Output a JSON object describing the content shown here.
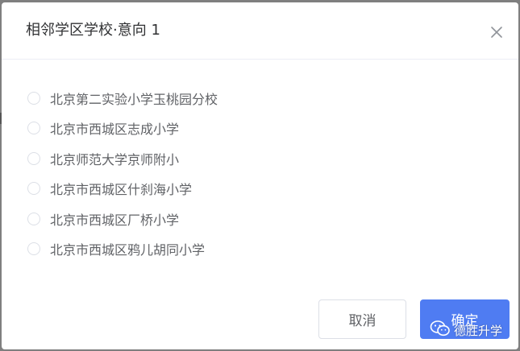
{
  "dialog": {
    "title": "相邻学区学校·意向 1",
    "close_icon": "close-icon",
    "options": [
      {
        "label": "北京第二实验小学玉桃园分校",
        "selected": false
      },
      {
        "label": "北京市西城区志成小学",
        "selected": false
      },
      {
        "label": "北京师范大学京师附小",
        "selected": false
      },
      {
        "label": "北京市西城区什刹海小学",
        "selected": false
      },
      {
        "label": "北京市西城区厂桥小学",
        "selected": false
      },
      {
        "label": "北京市西城区鸦儿胡同小学",
        "selected": false
      }
    ],
    "cancel_label": "取消",
    "confirm_label": "确定"
  },
  "watermark": {
    "icon": "wechat-icon",
    "text": "德胜升学"
  },
  "colors": {
    "primary": "#4f7cf2",
    "text_title": "#303133",
    "text_option": "#606266",
    "border": "#dcdfe6",
    "overlay": "#7f7f7f"
  }
}
